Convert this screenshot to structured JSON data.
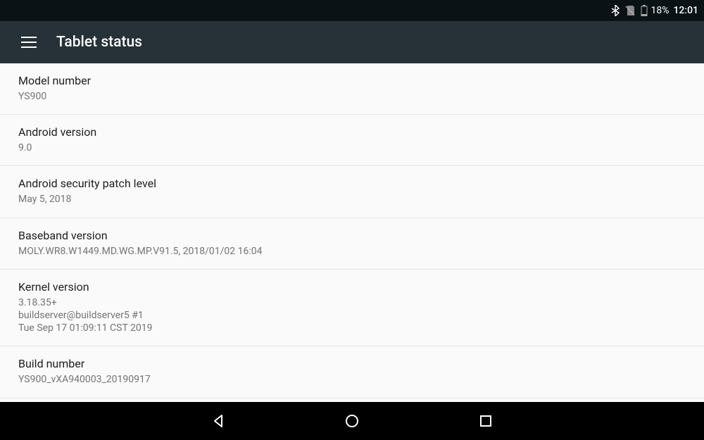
{
  "status_bar": {
    "battery_pct": "18%",
    "clock": "12:01"
  },
  "header": {
    "title": "Tablet status"
  },
  "rows": [
    {
      "label": "Model number",
      "value": "YS900"
    },
    {
      "label": "Android version",
      "value": "9.0"
    },
    {
      "label": "Android security patch level",
      "value": "May 5, 2018"
    },
    {
      "label": "Baseband version",
      "value": "MOLY.WR8.W1449.MD.WG.MP.V91.5, 2018/01/02 16:04"
    },
    {
      "label": "Kernel version",
      "value": "3.18.35+\nbuildserver@buildserver5 #1\nTue Sep 17 01:09:11 CST 2019"
    },
    {
      "label": "Build number",
      "value": "YS900_vXA940003_20190917"
    }
  ]
}
